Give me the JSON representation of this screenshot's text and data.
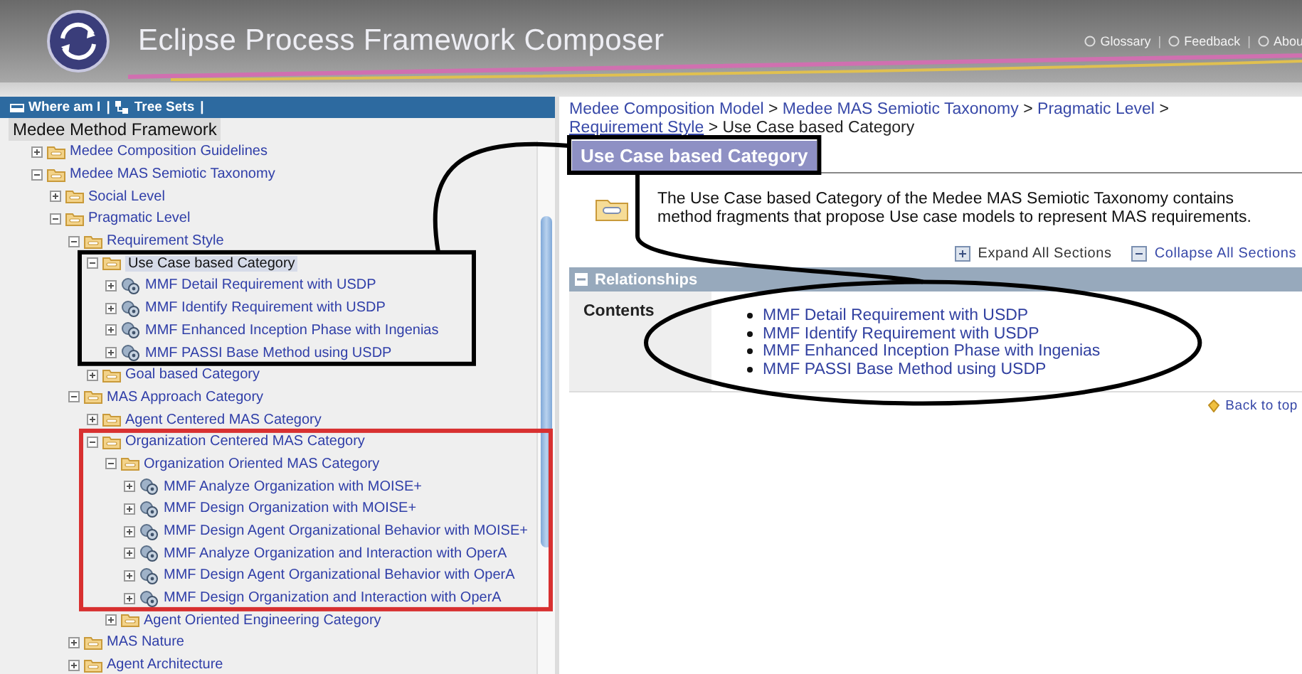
{
  "header": {
    "title": "Eclipse Process Framework Composer",
    "links": [
      "Glossary",
      "Feedback",
      "Abou"
    ],
    "separator": "|"
  },
  "nav_bar": {
    "items": [
      "Where am I",
      "Tree Sets"
    ],
    "separator": "|"
  },
  "tree": {
    "root": "Medee Method Framework",
    "items": [
      {
        "label": "Medee Composition Guidelines",
        "kind": "folder",
        "expanded": false,
        "selected": false
      },
      {
        "label": "Medee MAS Semiotic Taxonomy",
        "kind": "folder",
        "expanded": true,
        "selected": false,
        "children": [
          {
            "label": "Social Level",
            "kind": "folder",
            "expanded": false,
            "selected": false
          },
          {
            "label": "Pragmatic Level",
            "kind": "folder",
            "expanded": true,
            "selected": false,
            "children": [
              {
                "label": "Requirement Style",
                "kind": "folder",
                "expanded": true,
                "selected": false,
                "children": [
                  {
                    "label": "Use Case based Category",
                    "kind": "folder",
                    "expanded": true,
                    "selected": true,
                    "children": [
                      {
                        "label": "MMF Detail Requirement with USDP",
                        "kind": "fragment",
                        "expanded": false,
                        "selected": false
                      },
                      {
                        "label": "MMF Identify Requirement with USDP",
                        "kind": "fragment",
                        "expanded": false,
                        "selected": false
                      },
                      {
                        "label": "MMF Enhanced Inception Phase with Ingenias",
                        "kind": "fragment",
                        "expanded": false,
                        "selected": false
                      },
                      {
                        "label": "MMF PASSI Base Method using USDP",
                        "kind": "fragment",
                        "expanded": false,
                        "selected": false
                      }
                    ]
                  },
                  {
                    "label": "Goal based Category",
                    "kind": "folder",
                    "expanded": false,
                    "selected": false
                  }
                ]
              },
              {
                "label": "MAS Approach Category",
                "kind": "folder",
                "expanded": true,
                "selected": false,
                "children": [
                  {
                    "label": "Agent Centered MAS Category",
                    "kind": "folder",
                    "expanded": false,
                    "selected": false
                  },
                  {
                    "label": "Organization Centered MAS Category",
                    "kind": "folder",
                    "expanded": true,
                    "selected": false,
                    "children": [
                      {
                        "label": "Organization Oriented MAS Category",
                        "kind": "folder",
                        "expanded": true,
                        "selected": false,
                        "children": [
                          {
                            "label": "MMF Analyze Organization with MOISE+",
                            "kind": "fragment",
                            "expanded": false,
                            "selected": false
                          },
                          {
                            "label": "MMF Design Organization with MOISE+",
                            "kind": "fragment",
                            "expanded": false,
                            "selected": false
                          },
                          {
                            "label": "MMF Design Agent Organizational Behavior with MOISE+",
                            "kind": "fragment",
                            "expanded": false,
                            "selected": false
                          },
                          {
                            "label": "MMF Analyze Organization and Interaction with OperA",
                            "kind": "fragment",
                            "expanded": false,
                            "selected": false
                          },
                          {
                            "label": "MMF Design Agent Organizational Behavior with OperA",
                            "kind": "fragment",
                            "expanded": false,
                            "selected": false
                          },
                          {
                            "label": "MMF Design Organization and Interaction with OperA",
                            "kind": "fragment",
                            "expanded": false,
                            "selected": false
                          }
                        ]
                      },
                      {
                        "label": "Agent Oriented Engineering Category",
                        "kind": "folder",
                        "expanded": false,
                        "selected": false
                      }
                    ]
                  }
                ]
              },
              {
                "label": "MAS Nature",
                "kind": "folder",
                "expanded": false,
                "selected": false
              },
              {
                "label": "Agent Architecture",
                "kind": "folder",
                "expanded": false,
                "selected": false
              }
            ]
          }
        ]
      }
    ]
  },
  "breadcrumb": {
    "links": [
      "Medee Composition Model",
      "Medee MAS Semiotic Taxonomy",
      "Pragmatic Level",
      "Requirement Style"
    ],
    "separator": ">",
    "current": "Use Case based Category"
  },
  "page": {
    "title": "Use Case based Category",
    "description": "The Use Case based Category of the Medee MAS Semiotic Taxonomy contains method fragments that propose Use case models to represent MAS requirements.",
    "expand_all": "Expand All Sections",
    "collapse_all": "Collapse All Sections"
  },
  "relationships": {
    "title": "Relationships",
    "expanded": true,
    "rows": [
      {
        "label": "Contents",
        "links": [
          "MMF Detail Requirement with USDP",
          "MMF Identify Requirement with USDP",
          "MMF Enhanced Inception Phase with Ingenias",
          "MMF PASSI Base Method using USDP"
        ]
      }
    ]
  },
  "back_to_top": "Back to top"
}
